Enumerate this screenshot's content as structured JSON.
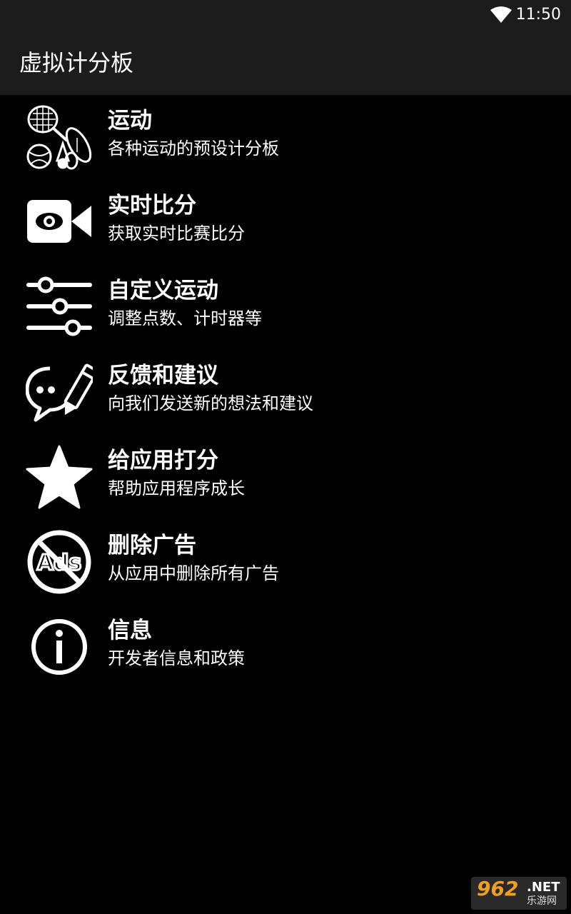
{
  "status_bar": {
    "time": "11:50",
    "wifi_icon": "wifi-icon"
  },
  "app_bar": {
    "title": "虚拟计分板"
  },
  "menu": {
    "items": [
      {
        "icon": "sports-icon",
        "label": "运动",
        "subtitle": "各种运动的预设计分板"
      },
      {
        "icon": "live-camera-icon",
        "label": "实时比分",
        "subtitle": "获取实时比赛比分"
      },
      {
        "icon": "sliders-icon",
        "label": "自定义运动",
        "subtitle": "调整点数、计时器等"
      },
      {
        "icon": "feedback-chat-icon",
        "label": "反馈和建议",
        "subtitle": "向我们发送新的想法和建议"
      },
      {
        "icon": "star-icon",
        "label": "给应用打分",
        "subtitle": "帮助应用程序成长"
      },
      {
        "icon": "no-ads-icon",
        "label": "删除广告",
        "subtitle": "从应用中删除所有广告",
        "icon_text": "Ads"
      },
      {
        "icon": "info-icon",
        "label": "信息",
        "subtitle": "开发者信息和政策"
      }
    ]
  },
  "watermark": {
    "number": "962",
    "net": ".NET",
    "site": "乐游网"
  },
  "colors": {
    "background": "#000000",
    "bar": "#1c1c1c",
    "text": "#ffffff",
    "watermark_accent": "#f0a020"
  }
}
